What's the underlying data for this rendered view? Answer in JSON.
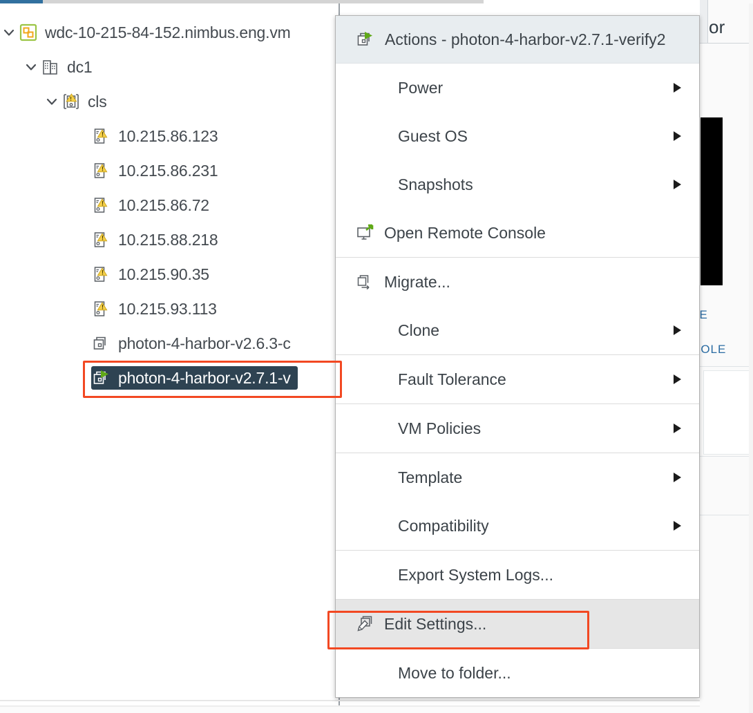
{
  "window": {
    "background_header_text": "or",
    "background_link_1": "LE",
    "background_link_2": "SOLE"
  },
  "tree": {
    "items": [
      {
        "label": "wdc-10-215-84-152.nimbus.eng.vm",
        "icon": "vcenter-icon",
        "indent": 0,
        "chevron": "expanded",
        "selected": false,
        "truncated": true
      },
      {
        "label": "dc1",
        "icon": "datacenter-icon",
        "indent": 1,
        "chevron": "expanded",
        "selected": false,
        "truncated": false
      },
      {
        "label": "cls",
        "icon": "cluster-warning-icon",
        "indent": 2,
        "chevron": "expanded",
        "selected": false,
        "truncated": false
      },
      {
        "label": "10.215.86.123",
        "icon": "host-warning-icon",
        "indent": 3,
        "chevron": "none",
        "selected": false,
        "truncated": false
      },
      {
        "label": "10.215.86.231",
        "icon": "host-warning-icon",
        "indent": 3,
        "chevron": "none",
        "selected": false,
        "truncated": false
      },
      {
        "label": "10.215.86.72",
        "icon": "host-warning-icon",
        "indent": 3,
        "chevron": "none",
        "selected": false,
        "truncated": false
      },
      {
        "label": "10.215.88.218",
        "icon": "host-warning-icon",
        "indent": 3,
        "chevron": "none",
        "selected": false,
        "truncated": false
      },
      {
        "label": "10.215.90.35",
        "icon": "host-warning-icon",
        "indent": 3,
        "chevron": "none",
        "selected": false,
        "truncated": false
      },
      {
        "label": "10.215.93.113",
        "icon": "host-warning-icon",
        "indent": 3,
        "chevron": "none",
        "selected": false,
        "truncated": false
      },
      {
        "label": "photon-4-harbor-v2.6.3-c",
        "icon": "vm-icon",
        "indent": 3,
        "chevron": "none",
        "selected": false,
        "truncated": true
      },
      {
        "label": "photon-4-harbor-v2.7.1-v",
        "icon": "vm-running-icon",
        "indent": 3,
        "chevron": "none",
        "selected": true,
        "truncated": true
      }
    ]
  },
  "context_menu": {
    "header": {
      "label": "Actions - photon-4-harbor-v2.7.1-verify2",
      "icon": "vm-running-icon"
    },
    "groups": [
      {
        "items": [
          {
            "label": "Power",
            "icon": "none",
            "submenu": true,
            "hovered": false
          },
          {
            "label": "Guest OS",
            "icon": "none",
            "submenu": true,
            "hovered": false
          },
          {
            "label": "Snapshots",
            "icon": "none",
            "submenu": true,
            "hovered": false
          },
          {
            "label": "Open Remote Console",
            "icon": "remote-console-icon",
            "submenu": false,
            "hovered": false
          }
        ]
      },
      {
        "items": [
          {
            "label": "Migrate...",
            "icon": "migrate-icon",
            "submenu": false,
            "hovered": false
          },
          {
            "label": "Clone",
            "icon": "none",
            "submenu": true,
            "hovered": false
          }
        ]
      },
      {
        "items": [
          {
            "label": "Fault Tolerance",
            "icon": "none",
            "submenu": true,
            "hovered": false
          }
        ]
      },
      {
        "items": [
          {
            "label": "VM Policies",
            "icon": "none",
            "submenu": true,
            "hovered": false
          }
        ]
      },
      {
        "items": [
          {
            "label": "Template",
            "icon": "none",
            "submenu": true,
            "hovered": false
          },
          {
            "label": "Compatibility",
            "icon": "none",
            "submenu": true,
            "hovered": false
          }
        ]
      },
      {
        "items": [
          {
            "label": "Export System Logs...",
            "icon": "none",
            "submenu": false,
            "hovered": false
          }
        ]
      },
      {
        "items": [
          {
            "label": "Edit Settings...",
            "icon": "edit-settings-icon",
            "submenu": false,
            "hovered": true
          }
        ]
      },
      {
        "items": [
          {
            "label": "Move to folder...",
            "icon": "none",
            "submenu": false,
            "hovered": false
          }
        ]
      }
    ]
  },
  "annotations": {
    "selected_vm_highlight": "photon-4-harbor-v2.7.1-v",
    "menu_item_highlight": "Edit Settings...",
    "color": "#f24822"
  },
  "colors": {
    "selection_background": "#2e4352",
    "menu_header_background": "#e8edf0",
    "menu_hover_background": "#e6e6e6",
    "accent_tab": "#31709f",
    "warning_yellow": "#f5d04a",
    "running_green": "#60a917",
    "link_blue": "#2b6ca3"
  }
}
